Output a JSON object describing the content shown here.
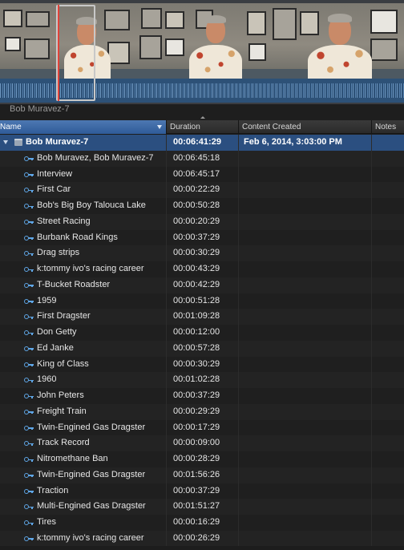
{
  "viewer": {
    "clip_name": "Bob Muravez-7"
  },
  "columns": {
    "name": "Name",
    "duration": "Duration",
    "content_created": "Content Created",
    "notes": "Notes"
  },
  "parent_row": {
    "name": "Bob Muravez-7",
    "duration": "00:06:41:29",
    "content_created": "Feb 6, 2014, 3:03:00 PM"
  },
  "rows": [
    {
      "name": "Bob Muravez, Bob Muravez-7",
      "display_name": "Bob Muravez, Bob Muravez",
      "duration": "00:06:45:18"
    },
    {
      "name": "Interview",
      "duration": "00:06:45:17"
    },
    {
      "name": "First Car",
      "duration": "00:00:22:29"
    },
    {
      "name": "Bob's Big Boy Talouca Lake",
      "duration": "00:00:50:28"
    },
    {
      "name": "Street Racing",
      "duration": "00:00:20:29"
    },
    {
      "name": "Burbank Road Kings",
      "duration": "00:00:37:29"
    },
    {
      "name": "Drag strips",
      "duration": "00:00:30:29"
    },
    {
      "name": "k:tommy ivo's racing career",
      "duration": "00:00:43:29"
    },
    {
      "name": "T-Bucket Roadster",
      "duration": "00:00:42:29"
    },
    {
      "name": "1959",
      "duration": "00:00:51:28"
    },
    {
      "name": "First Dragster",
      "duration": "00:01:09:28"
    },
    {
      "name": "Don Getty",
      "duration": "00:00:12:00"
    },
    {
      "name": "Ed Janke",
      "duration": "00:00:57:28"
    },
    {
      "name": "King of Class",
      "duration": "00:00:30:29"
    },
    {
      "name": "1960",
      "duration": "00:01:02:28"
    },
    {
      "name": "John Peters",
      "duration": "00:00:37:29"
    },
    {
      "name": "Freight Train",
      "duration": "00:00:29:29"
    },
    {
      "name": "Twin-Engined Gas Dragster",
      "duration": "00:00:17:29"
    },
    {
      "name": "Track Record",
      "duration": "00:00:09:00"
    },
    {
      "name": "Nitromethane Ban",
      "duration": "00:00:28:29"
    },
    {
      "name": "Twin-Engined Gas Dragster",
      "duration": "00:01:56:26"
    },
    {
      "name": "Traction",
      "duration": "00:00:37:29"
    },
    {
      "name": "Multi-Engined Gas Dragster",
      "duration": "00:01:51:27"
    },
    {
      "name": "Tires",
      "duration": "00:00:16:29"
    },
    {
      "name": "k:tommy ivo's racing career",
      "duration": "00:00:26:29"
    }
  ]
}
